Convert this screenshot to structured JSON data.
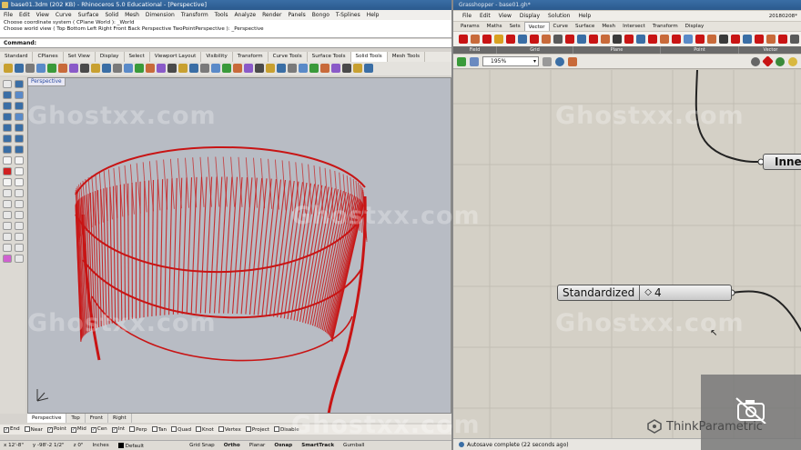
{
  "rhino": {
    "title": "base01.3dm (202 KB) - Rhinoceros 5.0 Educational - [Perspective]",
    "menu": [
      "File",
      "Edit",
      "View",
      "Curve",
      "Surface",
      "Solid",
      "Mesh",
      "Dimension",
      "Transform",
      "Tools",
      "Analyze",
      "Render",
      "Panels",
      "Bongo",
      "T-Splines",
      "Help"
    ],
    "history": [
      "Choose coordinate system ( CPlane  World ): _World",
      "Choose world view ( Top  Bottom  Left  Right  Front  Back  Perspective  TwoPointPerspective ): _Perspective"
    ],
    "command_label": "Command:",
    "toolbar_tabs": [
      "Standard",
      "CPlanes",
      "Set View",
      "Display",
      "Select",
      "Viewport Layout",
      "Visibility",
      "Transform",
      "Curve Tools",
      "Surface Tools",
      "Solid Tools",
      "Mesh Tools"
    ],
    "active_toolbar_tab": "Solid Tools",
    "viewport_label": "Perspective",
    "viewport_tabs": [
      "Perspective",
      "Top",
      "Front",
      "Right"
    ],
    "osnaps": [
      {
        "label": "End",
        "checked": true
      },
      {
        "label": "Near",
        "checked": false
      },
      {
        "label": "Point",
        "checked": true
      },
      {
        "label": "Mid",
        "checked": true
      },
      {
        "label": "Cen",
        "checked": true
      },
      {
        "label": "Int",
        "checked": true
      },
      {
        "label": "Perp",
        "checked": false
      },
      {
        "label": "Tan",
        "checked": false
      },
      {
        "label": "Quad",
        "checked": false
      },
      {
        "label": "Knot",
        "checked": false
      },
      {
        "label": "Vertex",
        "checked": false
      },
      {
        "label": "Project",
        "checked": false
      },
      {
        "label": "Disable",
        "checked": false
      }
    ],
    "status": {
      "x": "x 12'-8\"",
      "y": "y -98'-2 1/2\"",
      "z": "z 0\"",
      "units": "Inches",
      "layer": "Default",
      "grid_snap": "Grid Snap",
      "ortho": "Ortho",
      "planar": "Planar",
      "osnap": "Osnap",
      "smarttrack": "SmartTrack",
      "gumball": "Gumball"
    }
  },
  "grasshopper": {
    "title": "Grasshopper - base01.gh*",
    "menu": [
      "File",
      "Edit",
      "View",
      "Display",
      "Solution",
      "Help"
    ],
    "build": "20180208*",
    "tabs": [
      "Params",
      "Maths",
      "Sets",
      "Vector",
      "Curve",
      "Surface",
      "Mesh",
      "Intersect",
      "Transform",
      "Display"
    ],
    "active_tab": "Vector",
    "groups": [
      "Field",
      "Grid",
      "Plane",
      "Point",
      "Vector"
    ],
    "zoom": "195%",
    "status": "Autosave complete (22 seconds ago)",
    "node_standardized_label": "Standardized",
    "node_standardized_value": "4",
    "node_inner_label": "Inner"
  },
  "watermark_text": "Ghostxx.com",
  "brand_text": "ThinkParametric",
  "colors": {
    "curve_red": "#c81414",
    "viewport_bg": "#b8bcc4",
    "gh_canvas": "#d4d0c6"
  }
}
